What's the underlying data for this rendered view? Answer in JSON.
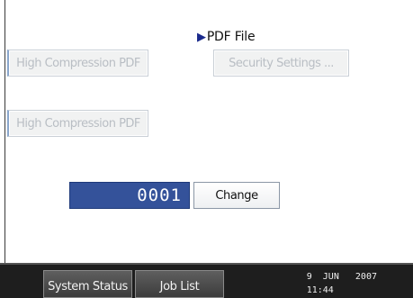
{
  "header": {
    "arrow": "▶",
    "label": "PDF File"
  },
  "row1": {
    "compression_button": "High Compression PDF",
    "security_button": "Security Settings ..."
  },
  "row2": {
    "compression_button": "High Compression PDF"
  },
  "counter": {
    "value": "0001",
    "change_label": "Change"
  },
  "status_bar": {
    "system_status_label": "System Status",
    "job_list_label": "Job List",
    "date": "9  JUN   2007",
    "time": "11:44"
  }
}
